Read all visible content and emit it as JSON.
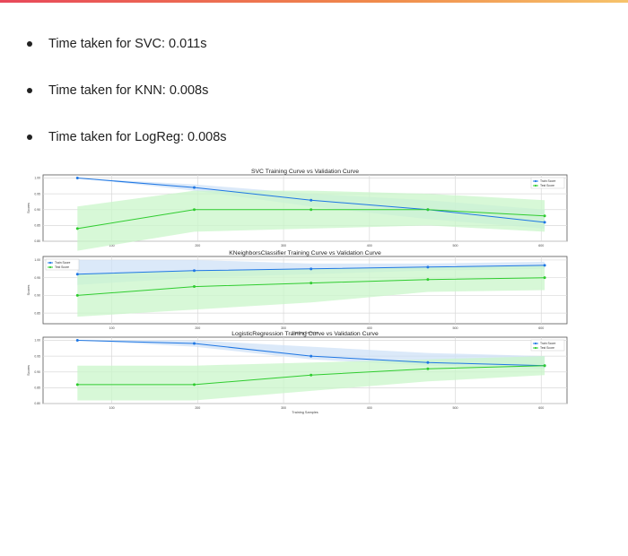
{
  "slide": {
    "bullets": [
      {
        "text": "Time taken for SVC: 0.011s"
      },
      {
        "text": "Time taken for KNN: 0.008s"
      },
      {
        "text": "Time taken for LogReg: 0.008s"
      }
    ]
  },
  "chart_data": [
    {
      "type": "line",
      "title": "SVC Training Curve vs Validation Curve",
      "xlabel": "",
      "ylabel": "Scores",
      "xlim": [
        20,
        630
      ],
      "ylim": [
        0.8,
        1.01
      ],
      "xticks": [
        100,
        200,
        300,
        400,
        500,
        600
      ],
      "yticks": [
        0.8,
        0.85,
        0.9,
        0.95,
        1.0
      ],
      "grid": true,
      "legend": "top-right",
      "series": [
        {
          "name": "Train Score",
          "color": "#1f77e4",
          "band": "#cfe2f7",
          "x": [
            60,
            196,
            332,
            468,
            604
          ],
          "y": [
            1.0,
            0.97,
            0.93,
            0.9,
            0.86
          ],
          "band_lo": [
            1.0,
            0.96,
            0.91,
            0.87,
            0.84
          ],
          "band_hi": [
            1.0,
            0.98,
            0.95,
            0.93,
            0.9
          ]
        },
        {
          "name": "Test Score",
          "color": "#2fcc2f",
          "band": "#c9f5c9",
          "x": [
            60,
            196,
            332,
            468,
            604
          ],
          "y": [
            0.84,
            0.9,
            0.9,
            0.9,
            0.88
          ],
          "band_lo": [
            0.77,
            0.83,
            0.84,
            0.85,
            0.83
          ],
          "band_hi": [
            0.91,
            0.96,
            0.96,
            0.95,
            0.93
          ]
        }
      ]
    },
    {
      "type": "line",
      "title": "KNeighborsClassifier Training Curve vs Validation Curve",
      "xlabel": "Training Samples",
      "ylabel": "Scores",
      "xlim": [
        20,
        630
      ],
      "ylim": [
        0.82,
        1.01
      ],
      "xticks": [
        100,
        200,
        300,
        400,
        500,
        600
      ],
      "yticks": [
        0.85,
        0.9,
        0.95,
        1.0
      ],
      "grid": true,
      "legend": "top-left",
      "series": [
        {
          "name": "Train Score",
          "color": "#1f77e4",
          "band": "#cfe2f7",
          "x": [
            60,
            196,
            332,
            468,
            604
          ],
          "y": [
            0.96,
            0.97,
            0.975,
            0.98,
            0.985
          ],
          "band_lo": [
            0.93,
            0.95,
            0.96,
            0.97,
            0.975
          ],
          "band_hi": [
            1.0,
            1.0,
            0.99,
            0.99,
            0.995
          ]
        },
        {
          "name": "Test Score",
          "color": "#2fcc2f",
          "band": "#c9f5c9",
          "x": [
            60,
            196,
            332,
            468,
            604
          ],
          "y": [
            0.9,
            0.925,
            0.935,
            0.945,
            0.95
          ],
          "band_lo": [
            0.84,
            0.86,
            0.88,
            0.91,
            0.915
          ],
          "band_hi": [
            0.96,
            0.97,
            0.975,
            0.98,
            0.985
          ]
        }
      ]
    },
    {
      "type": "line",
      "title": "LogisticRegression Training Curve vs Validation Curve",
      "xlabel": "Training Samples",
      "ylabel": "Scores",
      "xlim": [
        20,
        630
      ],
      "ylim": [
        0.8,
        1.01
      ],
      "xticks": [
        100,
        200,
        300,
        400,
        500,
        600
      ],
      "yticks": [
        0.8,
        0.85,
        0.9,
        0.95,
        1.0
      ],
      "grid": true,
      "legend": "top-right",
      "series": [
        {
          "name": "Train Score",
          "color": "#1f77e4",
          "band": "#cfe2f7",
          "x": [
            60,
            196,
            332,
            468,
            604
          ],
          "y": [
            1.0,
            0.99,
            0.95,
            0.93,
            0.92
          ],
          "band_lo": [
            1.0,
            0.98,
            0.94,
            0.92,
            0.91
          ],
          "band_hi": [
            1.0,
            1.0,
            0.98,
            0.96,
            0.95
          ]
        },
        {
          "name": "Test Score",
          "color": "#2fcc2f",
          "band": "#c9f5c9",
          "x": [
            60,
            196,
            332,
            468,
            604
          ],
          "y": [
            0.86,
            0.86,
            0.89,
            0.91,
            0.92
          ],
          "band_lo": [
            0.81,
            0.81,
            0.84,
            0.87,
            0.89
          ],
          "band_hi": [
            0.92,
            0.92,
            0.93,
            0.94,
            0.95
          ]
        }
      ]
    }
  ]
}
